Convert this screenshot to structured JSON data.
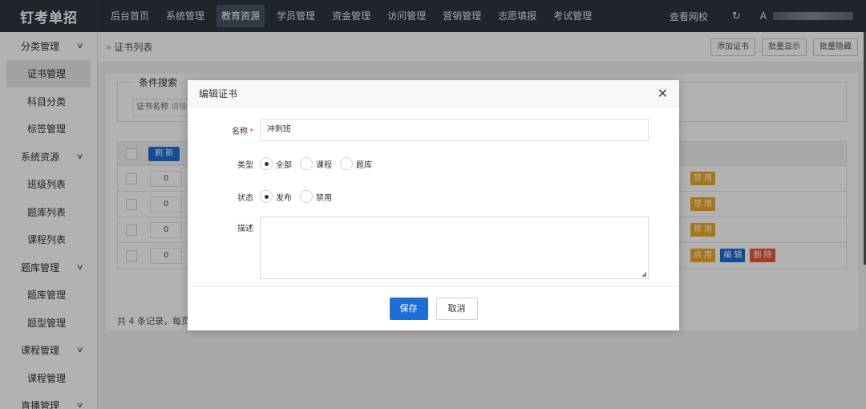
{
  "app": {
    "logo": "钉考单招"
  },
  "nav": {
    "items": [
      {
        "label": "后台首页"
      },
      {
        "label": "系统管理"
      },
      {
        "label": "教育资源"
      },
      {
        "label": "学员管理"
      },
      {
        "label": "资金管理"
      },
      {
        "label": "访问管理"
      },
      {
        "label": "营销管理"
      },
      {
        "label": "志愿填报"
      },
      {
        "label": "考试管理"
      }
    ],
    "active_index": 2
  },
  "topright": {
    "view_site": "查看网校",
    "refresh_icon": "refresh-icon",
    "user_icon": "user-icon"
  },
  "sidebar": {
    "groups": [
      {
        "label": "分类管理",
        "items": [
          "证书管理",
          "科目分类",
          "标签管理"
        ]
      },
      {
        "label": "系统资源",
        "items": [
          "班级列表",
          "题库列表",
          "课程列表"
        ]
      },
      {
        "label": "题库管理",
        "items": [
          "题库管理",
          "题型管理"
        ]
      },
      {
        "label": "课程管理",
        "items": [
          "课程管理"
        ]
      },
      {
        "label": "直播管理",
        "items": []
      }
    ],
    "active_item": "证书管理"
  },
  "content": {
    "breadcrumb": "证书列表",
    "actions": {
      "add": "添加证书",
      "batch_show": "批量显示",
      "batch_hide": "批量隐藏"
    },
    "search": {
      "legend": "条件搜索",
      "name_label": "证书名称",
      "placeholder": "请输"
    },
    "table": {
      "refresh": "刷 新",
      "rows": [
        {
          "sort": "0",
          "actions": [
            "禁 用"
          ]
        },
        {
          "sort": "0",
          "actions": [
            "禁 用"
          ]
        },
        {
          "sort": "0",
          "actions": [
            "禁 用"
          ]
        },
        {
          "sort": "0",
          "actions": [
            "启 用",
            "编 辑",
            "删 除"
          ]
        }
      ],
      "footer": "共 4 条记录，每页显示"
    }
  },
  "modal": {
    "title": "编辑证书",
    "close_icon": "close-icon",
    "name": {
      "label": "名称",
      "required": "*",
      "value": "冲刺班"
    },
    "type": {
      "label": "类型",
      "options": [
        "全部",
        "课程",
        "题库"
      ],
      "selected": "全部"
    },
    "status": {
      "label": "状态",
      "options": [
        "发布",
        "禁用"
      ],
      "selected": "发布"
    },
    "description": {
      "label": "描述",
      "value": ""
    },
    "buttons": {
      "save": "保存",
      "cancel": "取消"
    }
  },
  "colors": {
    "topbar": "#2f3640",
    "primary": "#1e6ed8",
    "warning": "#f1a922",
    "danger": "#ec5a3a"
  }
}
